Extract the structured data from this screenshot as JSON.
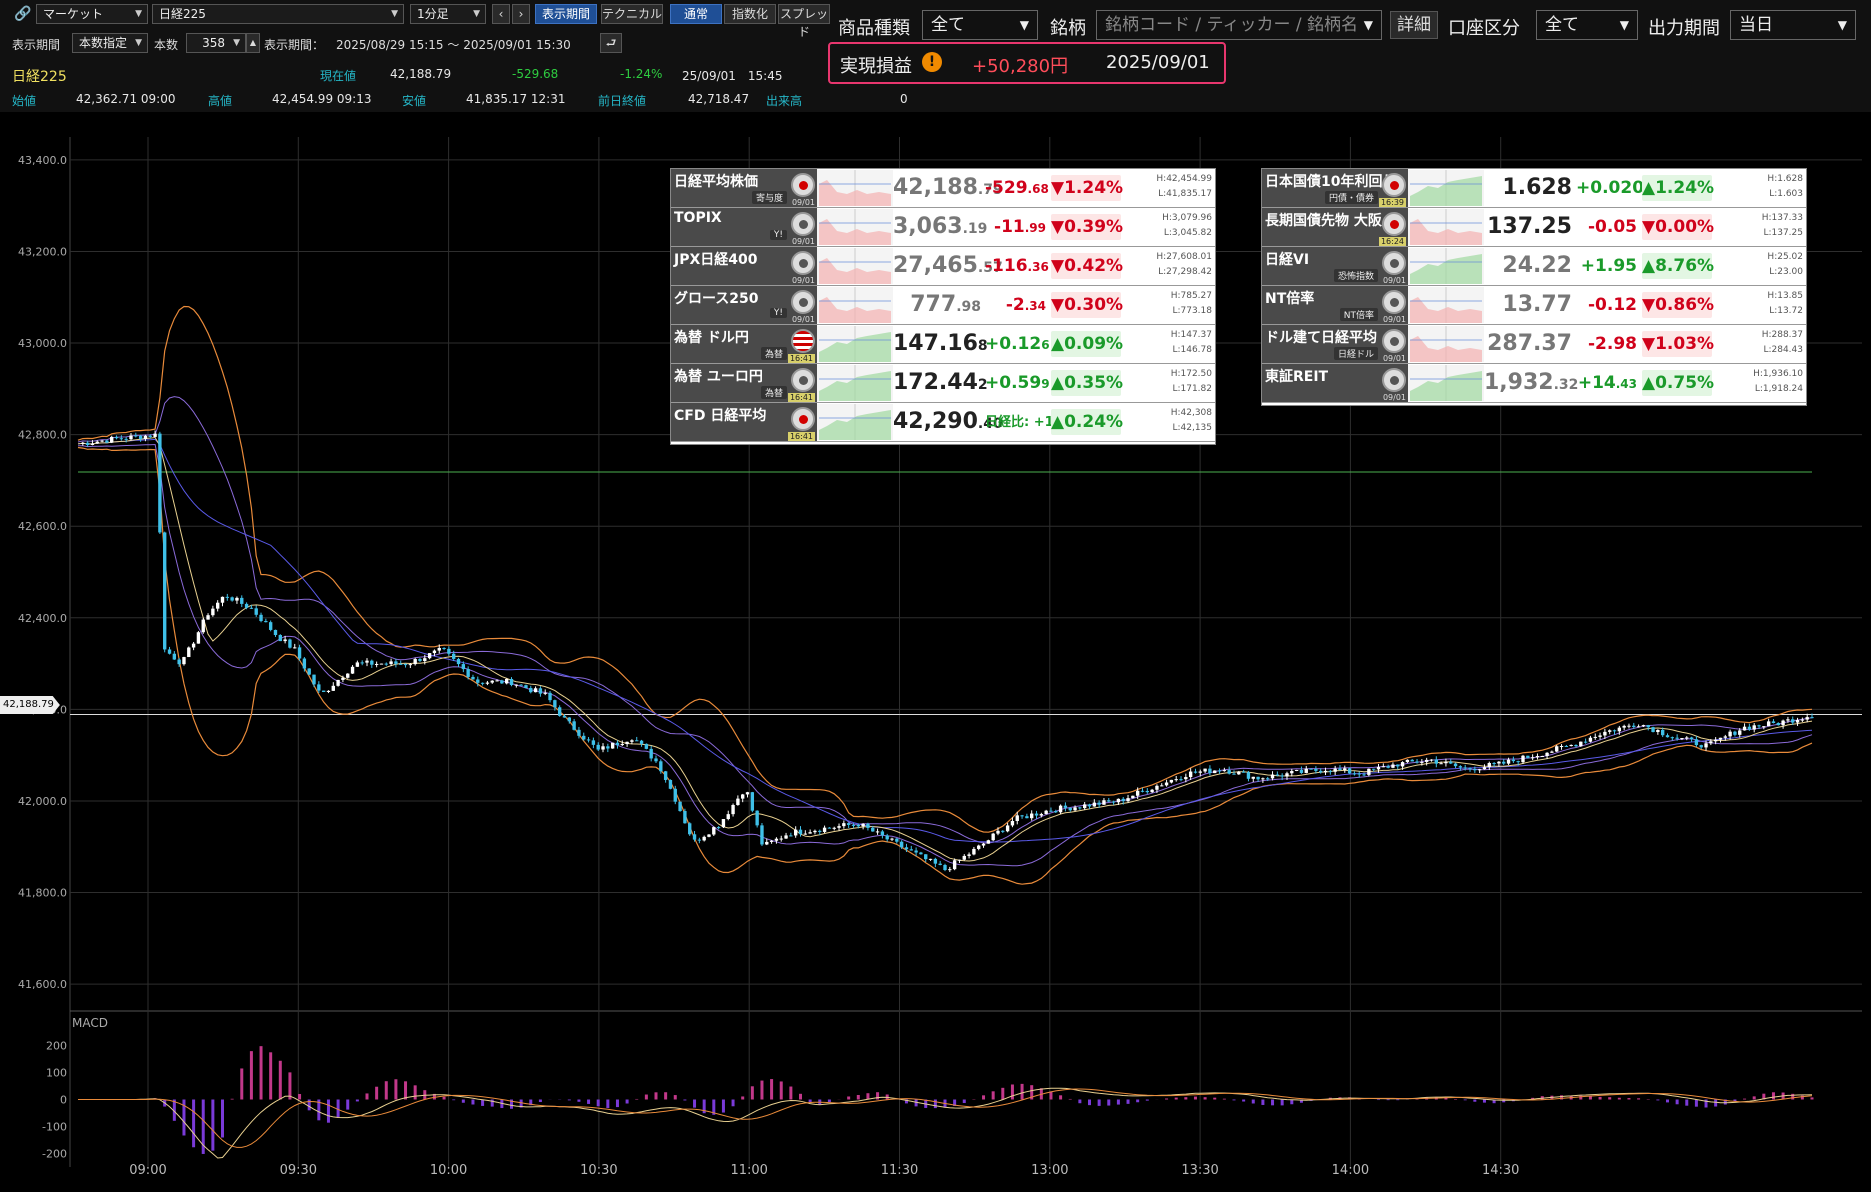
{
  "toolbar": {
    "market_select": "マーケット",
    "symbol_select": "日経225",
    "interval_select": "1分足",
    "btn_period": "表示期間",
    "btn_technical": "テクニカル",
    "btn_normal": "通常",
    "btn_index": "指数化",
    "btn_spread": "スプレッド",
    "period_label": "表示期間",
    "period_mode": "本数指定",
    "count_label": "本数",
    "count_value": "358",
    "range_label": "表示期間：",
    "range_value": "2025/08/29 15:15 ～ 2025/09/01 15:30"
  },
  "quote": {
    "name": "日経225",
    "current_label": "現在値",
    "current": "42,188.79",
    "change": "-529.68",
    "change_pct": "-1.24%",
    "datetime": "25/09/01　15:45",
    "open_label": "始値",
    "open": "42,362.71  09:00",
    "high_label": "高値",
    "high": "42,454.99  09:13",
    "low_label": "安値",
    "low": "41,835.17  12:31",
    "prev_label": "前日終値",
    "prev": "42,718.47",
    "volume_label": "出来高",
    "volume": "0"
  },
  "filters": {
    "product_label": "商品種類",
    "product_value": "全て",
    "symbol_label": "銘柄",
    "symbol_placeholder": "銘柄コード / ティッカー / 銘柄名",
    "detail_btn": "詳細",
    "account_label": "口座区分",
    "account_value": "全て",
    "output_label": "出力期間",
    "output_value": "当日"
  },
  "pnl": {
    "label": "実現損益",
    "value": "+50,280円",
    "date": "2025/09/01"
  },
  "chart": {
    "current_tag": "42,188.79",
    "macd_label": "MACD",
    "colors": {
      "up": "#ffffff",
      "down": "#3fc0e8",
      "bb_outer": "#e88a3a",
      "bb_mid": "#8a6ad8",
      "ma": "#e8d090",
      "hline": "#4caf50"
    }
  },
  "chart_data": {
    "type": "candlestick",
    "ylim": [
      41550,
      43450
    ],
    "yticks": [
      "43,400.0",
      "43,200.0",
      "43,000.0",
      "42,800.0",
      "42,600.0",
      "42,400.0",
      "42,200.0",
      "42,000.0",
      "41,800.0",
      "41,600.0"
    ],
    "ytick_values": [
      43400,
      43200,
      43000,
      42800,
      42600,
      42400,
      42200,
      42000,
      41800,
      41600
    ],
    "xticks": [
      "09:00",
      "09:30",
      "10:00",
      "10:30",
      "11:00",
      "11:30",
      "13:00",
      "13:30",
      "14:00",
      "14:30"
    ],
    "macd_yticks": [
      "200",
      "100",
      "0",
      "-100",
      "-200"
    ],
    "macd_ytick_values": [
      200,
      100,
      0,
      -100,
      -200
    ],
    "prev_close_level": 42718.47,
    "current_level": 42188.79,
    "price_path": [
      [
        0,
        42780
      ],
      [
        0.02,
        42790
      ],
      [
        0.045,
        42800
      ],
      [
        0.05,
        42330
      ],
      [
        0.06,
        42300
      ],
      [
        0.075,
        42410
      ],
      [
        0.085,
        42450
      ],
      [
        0.1,
        42420
      ],
      [
        0.115,
        42360
      ],
      [
        0.125,
        42330
      ],
      [
        0.14,
        42230
      ],
      [
        0.16,
        42300
      ],
      [
        0.19,
        42300
      ],
      [
        0.21,
        42330
      ],
      [
        0.23,
        42260
      ],
      [
        0.25,
        42260
      ],
      [
        0.27,
        42230
      ],
      [
        0.28,
        42180
      ],
      [
        0.3,
        42110
      ],
      [
        0.32,
        42140
      ],
      [
        0.335,
        42080
      ],
      [
        0.345,
        42000
      ],
      [
        0.355,
        41910
      ],
      [
        0.37,
        41950
      ],
      [
        0.385,
        42030
      ],
      [
        0.395,
        41900
      ],
      [
        0.41,
        41930
      ],
      [
        0.43,
        41940
      ],
      [
        0.45,
        41950
      ],
      [
        0.47,
        41910
      ],
      [
        0.49,
        41870
      ],
      [
        0.5,
        41850
      ],
      [
        0.52,
        41900
      ],
      [
        0.54,
        41960
      ],
      [
        0.56,
        41980
      ],
      [
        0.58,
        41990
      ],
      [
        0.6,
        42000
      ],
      [
        0.62,
        42030
      ],
      [
        0.64,
        42060
      ],
      [
        0.66,
        42070
      ],
      [
        0.68,
        42050
      ],
      [
        0.7,
        42060
      ],
      [
        0.72,
        42070
      ],
      [
        0.74,
        42060
      ],
      [
        0.76,
        42080
      ],
      [
        0.78,
        42090
      ],
      [
        0.8,
        42070
      ],
      [
        0.82,
        42080
      ],
      [
        0.84,
        42100
      ],
      [
        0.86,
        42120
      ],
      [
        0.88,
        42150
      ],
      [
        0.9,
        42170
      ],
      [
        0.92,
        42140
      ],
      [
        0.94,
        42120
      ],
      [
        0.96,
        42160
      ],
      [
        0.98,
        42170
      ],
      [
        1,
        42188
      ]
    ]
  },
  "markets_left": [
    {
      "name": "日経平均株価",
      "sub": "寄与度",
      "flag": "jp",
      "date": "09/01",
      "price": "42,188",
      "price_dec": ".79",
      "grey": true,
      "chg": "-529",
      "chg_dec": ".68",
      "dir": "dn",
      "pct": "▼1.24%",
      "h": "H:42,454.99",
      "l": "L:41,835.17"
    },
    {
      "name": "TOPIX",
      "sub": "Y!",
      "flag": "gray",
      "date": "09/01",
      "price": "3,063",
      "price_dec": ".19",
      "grey": true,
      "chg": "-11",
      "chg_dec": ".99",
      "dir": "dn",
      "pct": "▼0.39%",
      "h": "H:3,079.96",
      "l": "L:3,045.82"
    },
    {
      "name": "JPX日経400",
      "sub": "",
      "flag": "gray",
      "date": "09/01",
      "price": "27,465",
      "price_dec": ".57",
      "grey": true,
      "chg": "-116",
      "chg_dec": ".36",
      "dir": "dn",
      "pct": "▼0.42%",
      "h": "H:27,608.01",
      "l": "L:27,298.42"
    },
    {
      "name": "グロース250",
      "sub": "Y!",
      "flag": "gray",
      "date": "09/01",
      "price": "777",
      "price_dec": ".98",
      "grey": true,
      "chg": "-2",
      "chg_dec": ".34",
      "dir": "dn",
      "pct": "▼0.30%",
      "h": "H:785.27",
      "l": "L:773.18"
    },
    {
      "name": "為替 ドル円",
      "sub": "為替",
      "flag": "us",
      "date": "16:41",
      "hl_date": true,
      "price": "147.16",
      "price_dec": "8",
      "grey": false,
      "chg": "+0.12",
      "chg_dec": "6",
      "dir": "up",
      "pct": "▲0.09%",
      "h": "H:147.37",
      "l": "L:146.78"
    },
    {
      "name": "為替 ユーロ円",
      "sub": "為替",
      "flag": "gray",
      "date": "16:41",
      "hl_date": true,
      "price": "172.44",
      "price_dec": "2",
      "grey": false,
      "chg": "+0.59",
      "chg_dec": "9",
      "dir": "up",
      "pct": "▲0.35%",
      "h": "H:172.50",
      "l": "L:171.82"
    },
    {
      "name": "CFD 日経平均",
      "sub": "",
      "flag": "jp",
      "date": "16:41",
      "hl_date": true,
      "price": "42,290",
      "price_dec": ".40",
      "grey": false,
      "chg": "日経比: +101",
      "chg_dec": "",
      "dir": "up",
      "pct": "▲0.24%",
      "h": "H:42,308",
      "l": "L:42,135"
    }
  ],
  "markets_right": [
    {
      "name": "日本国債10年利回り",
      "sub": "円債・債券",
      "flag": "jp",
      "date": "16:39",
      "hl_date": true,
      "price": "1.628",
      "price_dec": "",
      "grey": false,
      "chg": "+0.020",
      "chg_dec": "",
      "dir": "up",
      "pct": "▲1.24%",
      "h": "H:1.628",
      "l": "L:1.603"
    },
    {
      "name": "長期国債先物 大阪",
      "sub": "",
      "flag": "jp",
      "date": "16:24",
      "hl_date": true,
      "price": "137.25",
      "price_dec": "",
      "grey": false,
      "chg": "-0.05",
      "chg_dec": "",
      "dir": "dn",
      "pct": "▼0.00%",
      "h": "H:137.33",
      "l": "L:137.25"
    },
    {
      "name": "日経VI",
      "sub": "恐怖指数",
      "flag": "gray",
      "date": "09/01",
      "price": "24.22",
      "price_dec": "",
      "grey": true,
      "chg": "+1.95",
      "chg_dec": "",
      "dir": "up",
      "pct": "▲8.76%",
      "h": "H:25.02",
      "l": "L:23.00"
    },
    {
      "name": "NT倍率",
      "sub": "NT倍率",
      "flag": "gray",
      "date": "09/01",
      "price": "13.77",
      "price_dec": "",
      "grey": true,
      "chg": "-0.12",
      "chg_dec": "",
      "dir": "dn",
      "pct": "▼0.86%",
      "h": "H:13.85",
      "l": "L:13.72"
    },
    {
      "name": "ドル建て日経平均",
      "sub": "日経ドル",
      "flag": "gray",
      "date": "09/01",
      "price": "287.37",
      "price_dec": "",
      "grey": true,
      "chg": "-2.98",
      "chg_dec": "",
      "dir": "dn",
      "pct": "▼1.03%",
      "h": "H:288.37",
      "l": "L:284.43"
    },
    {
      "name": "東証REIT",
      "sub": "",
      "flag": "gray",
      "date": "09/01",
      "price": "1,932",
      "price_dec": ".32",
      "grey": true,
      "chg": "+14",
      "chg_dec": ".43",
      "dir": "up",
      "pct": "▲0.75%",
      "h": "H:1,936.10",
      "l": "L:1,918.24"
    }
  ]
}
